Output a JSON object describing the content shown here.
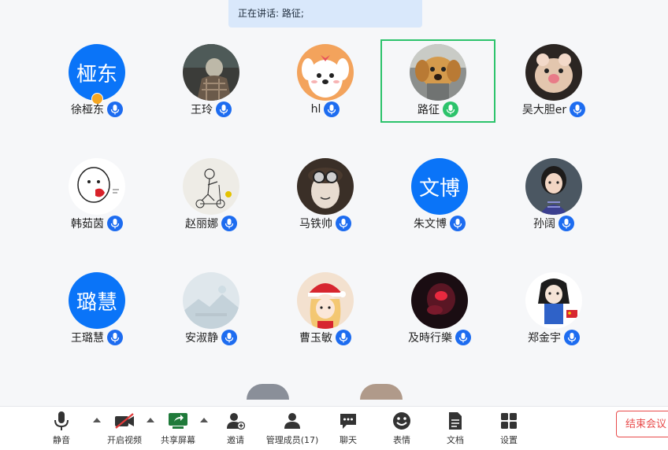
{
  "speaking": {
    "text": "正在讲话: 路征;"
  },
  "participants": [
    {
      "name": "徐桠东",
      "avatar_text": "桠东",
      "avatar_type": "text",
      "host": true
    },
    {
      "name": "王玲",
      "avatar_type": "photo-person-back",
      "host": false
    },
    {
      "name": "hl",
      "avatar_type": "photo-cartoon-dog",
      "host": false
    },
    {
      "name": "路征",
      "avatar_type": "photo-golden-puppy",
      "host": false,
      "active": true
    },
    {
      "name": "吴大胆er",
      "avatar_type": "photo-pet",
      "host": false
    },
    {
      "name": "韩茹茵",
      "avatar_type": "photo-cartoon-heart",
      "host": false
    },
    {
      "name": "赵丽娜",
      "avatar_type": "photo-sketch-scooter",
      "host": false
    },
    {
      "name": "马铁帅",
      "avatar_type": "photo-goggles",
      "host": false
    },
    {
      "name": "朱文博",
      "avatar_text": "文博",
      "avatar_type": "text",
      "host": false
    },
    {
      "name": "孙阔",
      "avatar_type": "photo-illustration-girl",
      "host": false
    },
    {
      "name": "王璐慧",
      "avatar_text": "璐慧",
      "avatar_type": "text",
      "host": false
    },
    {
      "name": "安淑静",
      "avatar_type": "photo-placeholder",
      "host": false
    },
    {
      "name": "曹玉敏",
      "avatar_type": "photo-christmas-girl",
      "host": false
    },
    {
      "name": "及時行樂",
      "avatar_type": "photo-dark-red",
      "host": false
    },
    {
      "name": "郑金宇",
      "avatar_type": "photo-cartoon-girl-flag",
      "host": false
    }
  ],
  "toolbar": {
    "mute": "静音",
    "video": "开启视频",
    "share": "共享屏幕",
    "invite": "邀请",
    "manage": "管理成员(17)",
    "chat": "聊天",
    "emoji": "表情",
    "docs": "文档",
    "settings": "设置",
    "end": "结束会议"
  },
  "colors": {
    "accent": "#1d6cf0",
    "avatar_blue": "#0a74f8",
    "active_border": "#2cc36b",
    "end_red": "#e84a4a"
  }
}
